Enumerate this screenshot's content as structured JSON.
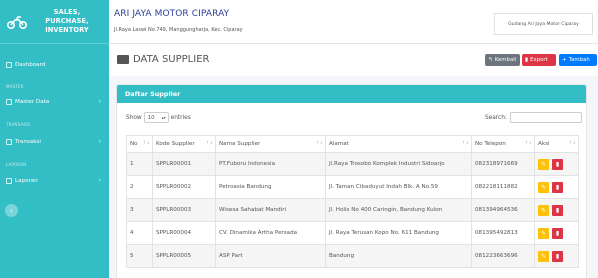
{
  "brand": {
    "line1": "SALES,",
    "line2": "PURCHASE,",
    "line3": "INVENTORY",
    "logo_icon": "motorcycle-icon"
  },
  "sidebar": {
    "dashboard": "Dashboard",
    "master_head": "MASTER",
    "master_data": "Master Data",
    "transaksi_head": "TRANSAKSI",
    "transaksi": "Transaksi",
    "laporan_head": "LAPORAN",
    "laporan": "Laporan",
    "toggle": "‹"
  },
  "topbar": {
    "company": "ARI JAYA MOTOR CIPARAY",
    "address": "Jl.Raya Laswi No.749, Manggungharja, Kec. Ciparay",
    "user": "Gudang Ari Jaya Motor Ciparay"
  },
  "header": {
    "title": "DATA SUPPLIER",
    "kembali": "Kembali",
    "export": "Export",
    "tambah": "Tambah"
  },
  "card": {
    "title": "Daftar Supplier",
    "show": "Show",
    "entries_value": "10",
    "entries": "entries",
    "search": "Search:"
  },
  "table": {
    "headers": [
      "No",
      "Kode Supplier",
      "Nama Supplier",
      "Alamat",
      "No Telepon",
      "Aksi"
    ],
    "rows": [
      [
        "1",
        "SPPLR00001",
        "PT.Fuboru Indonesia",
        "Jl.Raya Trosobo Komplek Industri Sidoarjo",
        "082318971669"
      ],
      [
        "2",
        "SPPLR00002",
        "Petroasia Bandung",
        "Jl. Taman Cibaduyut Indah Blk. A No.59",
        "082218111882"
      ],
      [
        "3",
        "SPPLR00003",
        "Wisesa Sahabat Mandiri",
        "Jl. Holis No 400 Caringin, Bandung Kulon",
        "081394964536"
      ],
      [
        "4",
        "SPPLR00004",
        "CV. Dinamika Artha Persada",
        "Jl. Raya Terusan Kopo No. 611 Bandung",
        "081395492813"
      ],
      [
        "5",
        "SPPLR00005",
        "ASP Part",
        "Bandung",
        "081223663696"
      ]
    ]
  },
  "colors": {
    "primary": "#33bdc5",
    "title": "#2c3e9a",
    "danger": "#dc3545",
    "warning": "#ffc107",
    "info": "#007bff",
    "secondary": "#6c757d"
  }
}
